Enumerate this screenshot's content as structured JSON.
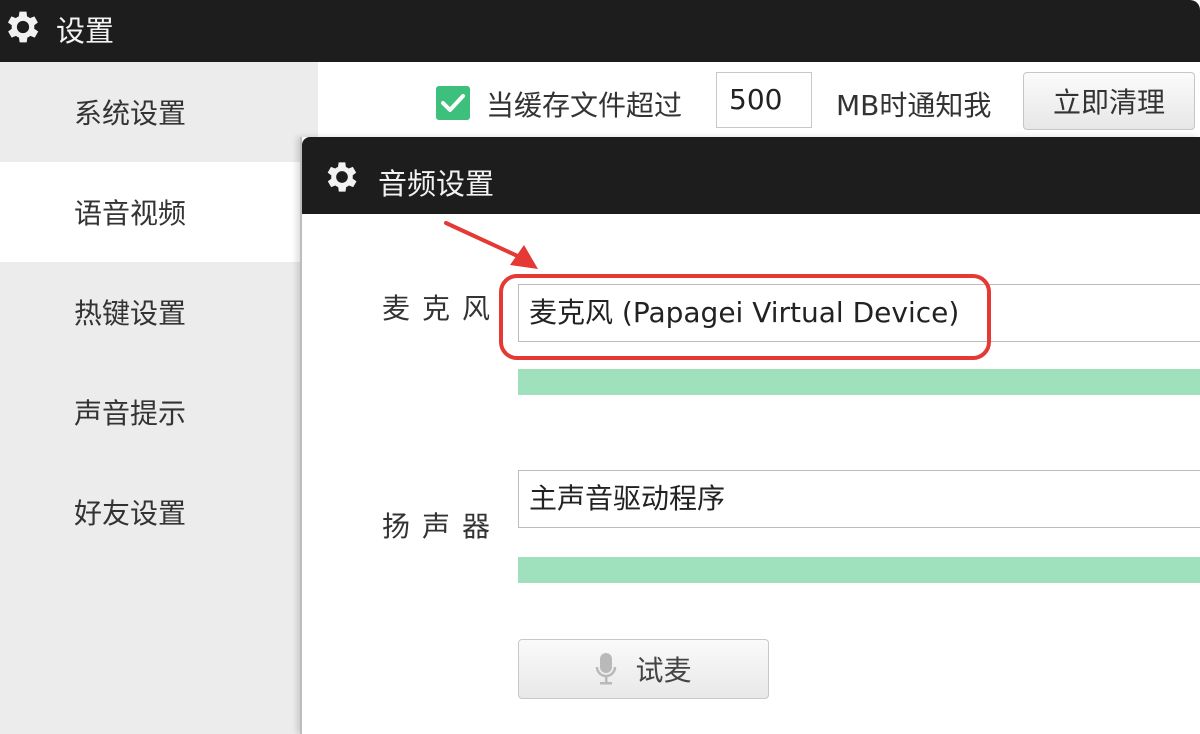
{
  "window": {
    "title": "设置",
    "icon": "gear-icon"
  },
  "sidebar": {
    "items": [
      {
        "label": "系统设置",
        "active": false
      },
      {
        "label": "语音视频",
        "active": true
      },
      {
        "label": "热键设置",
        "active": false
      },
      {
        "label": "声音提示",
        "active": false
      },
      {
        "label": "好友设置",
        "active": false
      }
    ]
  },
  "cache": {
    "checked": true,
    "label": "当缓存文件超过",
    "value": "500",
    "unit": "MB时通知我",
    "clean_button": "立即清理"
  },
  "audio": {
    "title": "音频设置",
    "icon": "gear-icon",
    "microphone": {
      "label": "麦克风",
      "value": "麦克风 (Papagei Virtual Device)"
    },
    "speaker": {
      "label": "扬声器",
      "value": "主声音驱动程序"
    },
    "test_button": "试麦",
    "test_icon": "microphone-icon"
  },
  "colors": {
    "titlebar": "#1d1d1d",
    "checkbox": "#3cc07b",
    "level_meter": "#9fe0bd",
    "annotation": "#e53935"
  }
}
